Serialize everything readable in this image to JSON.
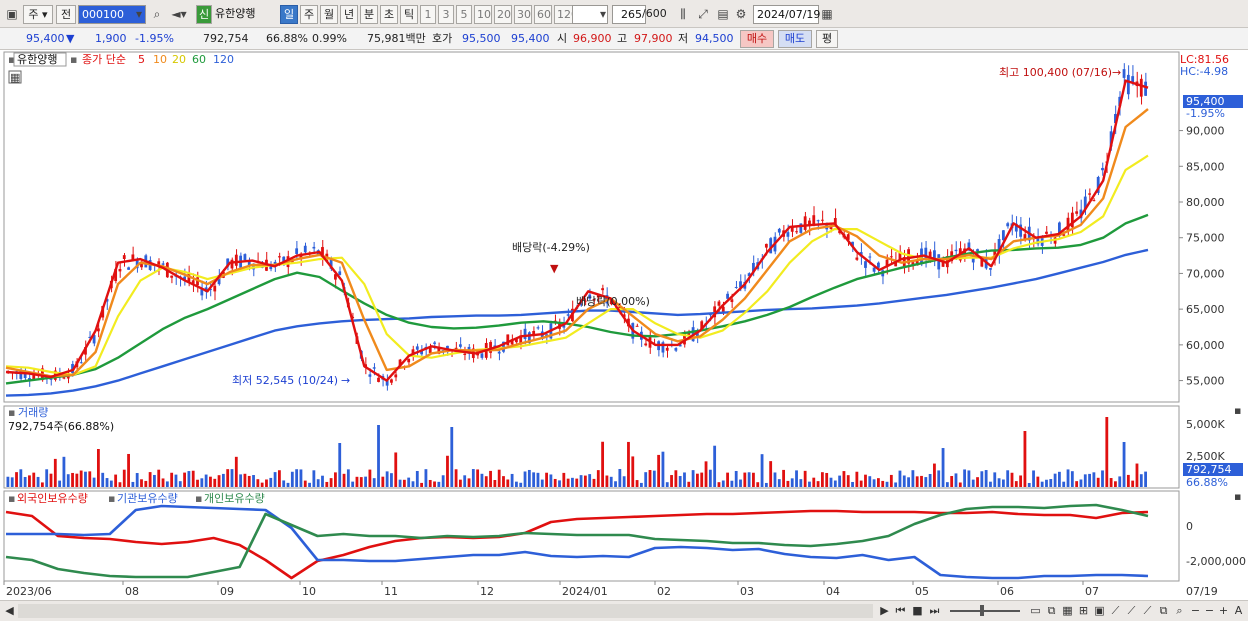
{
  "toolbar": {
    "period_label": "주",
    "prev_label": "전",
    "code_value": "000100",
    "market_badge": "신",
    "stock_name": "유한양행",
    "tab_day": "일",
    "tab_week": "주",
    "tab_month": "월",
    "tab_year": "년",
    "tab_minute": "분",
    "tab_second": "초",
    "tab_tick": "틱",
    "intervals": [
      "1",
      "3",
      "5",
      "10",
      "20",
      "30",
      "60",
      "120"
    ],
    "count_value": "265",
    "count_max": "/600",
    "date_value": "2024/07/19"
  },
  "quote": {
    "price": "95,400",
    "change_arrow": "▼",
    "change": "1,900",
    "change_pct": "-1.95%",
    "volume": "792,754",
    "turnover_pct": "66.88%",
    "rate": "0.99%",
    "amount": "75,981백만",
    "bid_label": "호가",
    "bid1": "95,500",
    "bid2": "95,400",
    "open_label": "시",
    "open": "96,900",
    "high_label": "고",
    "high": "97,900",
    "low_label": "저",
    "low": "94,500",
    "buy_label": "매수",
    "sell_label": "매도",
    "eval_label": "평"
  },
  "price_panel": {
    "name_tag": "유한양행",
    "ma_title": "종가 단순",
    "ma_periods": [
      "5",
      "10",
      "20",
      "60",
      "120"
    ],
    "ma_colors": [
      "#e01010",
      "#f08a1c",
      "#f2ec20",
      "#1f9a3c",
      "#2d5fd8"
    ],
    "lc": "LC:81.56",
    "hc": "HC:-4.98",
    "high_note": "최고 100,400 (07/16)",
    "low_note": "최저 52,545 (10/24)",
    "dividend_note": "배당락(-4.29%)",
    "adjust_note": "배당락(0.00%)",
    "current_price": "95,400",
    "current_pct": "-1.95%",
    "y_ticks": [
      "90,000",
      "85,000",
      "80,000",
      "75,000",
      "70,000",
      "65,000",
      "60,000",
      "55,000"
    ]
  },
  "volume_panel": {
    "title": "거래량",
    "subtitle": "792,754주(66.88%)",
    "y_ticks": [
      "5,000K",
      "2,500K"
    ],
    "current": "792,754",
    "current_pct": "66.88%"
  },
  "holder_panel": {
    "series": [
      "외국인보유수량",
      "기관보유수량",
      "개인보유수량"
    ],
    "colors": [
      "#e01010",
      "#2d5fd8",
      "#2f8a4e"
    ],
    "y_ticks": [
      "0",
      "-2,000,000"
    ]
  },
  "x_axis": {
    "labels": [
      "2023/06",
      "08",
      "09",
      "10",
      "11",
      "12",
      "2024/01",
      "02",
      "03",
      "04",
      "05",
      "06",
      "07"
    ],
    "end_label": "07/19"
  },
  "chart_data": {
    "type": "line",
    "title": "유한양행",
    "x_range": [
      "2023/06",
      "2024/07/19"
    ],
    "y_range": [
      52000,
      101000
    ],
    "candles_summary": {
      "high": 100400,
      "high_date": "07/16",
      "low": 52545,
      "low_date": "10/24",
      "last": 95400
    },
    "series": [
      {
        "name": "5",
        "values": [
          56200,
          56000,
          55500,
          56500,
          62000,
          71500,
          72000,
          70800,
          69000,
          67500,
          71500,
          71800,
          71000,
          72500,
          73000,
          69000,
          57000,
          55000,
          58500,
          59800,
          59200,
          58800,
          59800,
          61200,
          61500,
          63000,
          67500,
          66500,
          62000,
          60000,
          60000,
          62000,
          65500,
          68500,
          73000,
          76500,
          76800,
          77000,
          73000,
          70500,
          72000,
          72500,
          71500,
          73500,
          71000,
          77000,
          75000,
          75500,
          78000,
          83000,
          97000,
          96000
        ]
      },
      {
        "name": "10",
        "values": [
          56800,
          56200,
          55600,
          55800,
          59000,
          68500,
          71500,
          71000,
          69800,
          68500,
          70200,
          71200,
          71200,
          72000,
          72600,
          71500,
          63500,
          56500,
          57000,
          58800,
          59300,
          59200,
          59300,
          60200,
          61000,
          62000,
          65000,
          66500,
          64000,
          61500,
          60500,
          61200,
          63500,
          66500,
          70500,
          74500,
          76200,
          76700,
          75200,
          72500,
          71500,
          72000,
          72000,
          72600,
          72000,
          74500,
          75000,
          75300,
          76800,
          80500,
          90500,
          93000
        ]
      },
      {
        "name": "20",
        "values": [
          57000,
          56800,
          56200,
          55800,
          57000,
          64000,
          69000,
          70800,
          70200,
          69200,
          70000,
          70800,
          71200,
          71500,
          72000,
          72200,
          68500,
          61500,
          58500,
          58200,
          58800,
          59300,
          59500,
          59800,
          60400,
          61000,
          63000,
          65000,
          65000,
          63000,
          61500,
          61000,
          62000,
          64500,
          67500,
          71500,
          74500,
          76200,
          76200,
          74500,
          72800,
          72000,
          72000,
          72200,
          72200,
          73500,
          74300,
          74800,
          75800,
          78000,
          84500,
          86500
        ]
      },
      {
        "name": "60",
        "values": [
          54600,
          55000,
          55400,
          55800,
          56600,
          58200,
          60200,
          62200,
          63800,
          65000,
          66400,
          67800,
          69200,
          70100,
          69500,
          67600,
          65800,
          64200,
          63100,
          62500,
          62300,
          62400,
          62700,
          63100,
          63300,
          63000,
          62500,
          61800,
          61300,
          61200,
          61500,
          62000,
          62600,
          63300,
          64200,
          65300,
          66700,
          68000,
          69200,
          70000,
          70800,
          71500,
          72200,
          72800,
          73200,
          73300,
          73500,
          73600,
          74000,
          75000,
          77000,
          78200
        ]
      },
      {
        "name": "120",
        "values": [
          52900,
          53000,
          53200,
          53600,
          54200,
          55000,
          56000,
          57000,
          58000,
          59000,
          60000,
          61000,
          62000,
          62600,
          63000,
          63300,
          63500,
          63600,
          63700,
          63900,
          64000,
          64100,
          64100,
          64200,
          64400,
          64600,
          64800,
          64800,
          64600,
          64400,
          64200,
          64300,
          64500,
          64700,
          64900,
          65000,
          65100,
          65300,
          65500,
          65800,
          66200,
          66600,
          67000,
          67500,
          68000,
          68600,
          69200,
          70000,
          70800,
          71600,
          72600,
          73300
        ]
      }
    ]
  }
}
